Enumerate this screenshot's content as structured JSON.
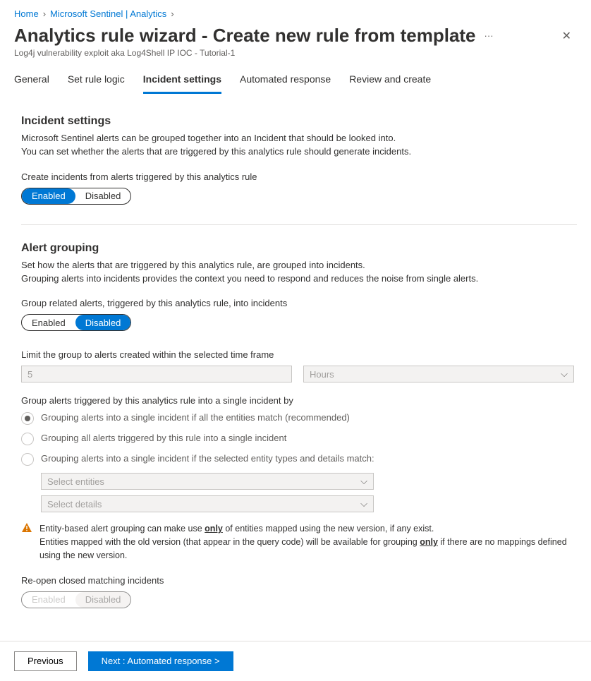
{
  "breadcrumb": {
    "home": "Home",
    "l1": "Microsoft Sentinel | Analytics"
  },
  "header": {
    "title": "Analytics rule wizard - Create new rule from template",
    "subtitle": "Log4j vulnerability exploit aka Log4Shell IP IOC - Tutorial-1"
  },
  "tabs": {
    "general": "General",
    "logic": "Set rule logic",
    "incident": "Incident settings",
    "automated": "Automated response",
    "review": "Review and create"
  },
  "incident": {
    "heading": "Incident settings",
    "desc1": "Microsoft Sentinel alerts can be grouped together into an Incident that should be looked into.",
    "desc2": "You can set whether the alerts that are triggered by this analytics rule should generate incidents.",
    "createLabel": "Create incidents from alerts triggered by this analytics rule",
    "enabled": "Enabled",
    "disabled": "Disabled"
  },
  "grouping": {
    "heading": "Alert grouping",
    "desc1": "Set how the alerts that are triggered by this analytics rule, are grouped into incidents.",
    "desc2": "Grouping alerts into incidents provides the context you need to respond and reduces the noise from single alerts.",
    "groupLabel": "Group related alerts, triggered by this analytics rule, into incidents",
    "limitLabel": "Limit the group to alerts created within the selected time frame",
    "limitValue": "5",
    "limitUnit": "Hours",
    "singleLabel": "Group alerts triggered by this analytics rule into a single incident by",
    "radio1": "Grouping alerts into a single incident if all the entities match (recommended)",
    "radio2": "Grouping all alerts triggered by this rule into a single incident",
    "radio3": "Grouping alerts into a single incident if the selected entity types and details match:",
    "selectEntities": "Select entities",
    "selectDetails": "Select details",
    "warnPart1": "Entity-based alert grouping can make use ",
    "warnOnly": "only",
    "warnPart2": " of entities mapped using the new version, if any exist.",
    "warnPart3": "Entities mapped with the old version (that appear in the query code) will be available for grouping ",
    "warnPart4": " if there are no mappings defined using the new version.",
    "reopenLabel": "Re-open closed matching incidents"
  },
  "footer": {
    "prev": "Previous",
    "next": "Next : Automated response >"
  }
}
